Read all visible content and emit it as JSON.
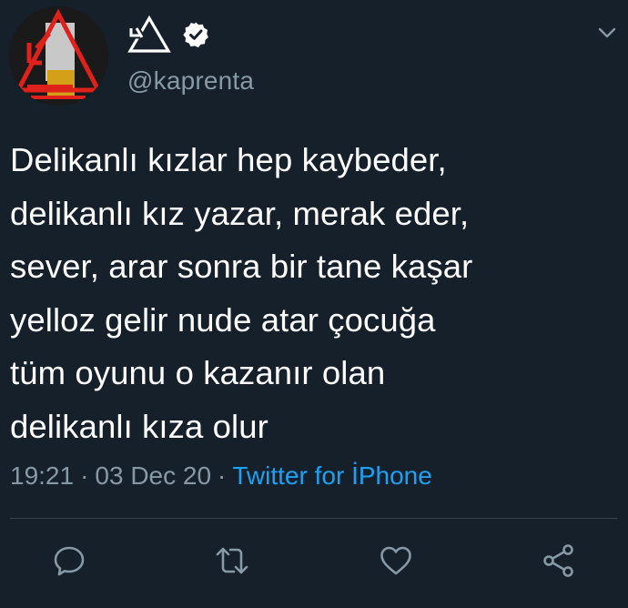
{
  "tweet": {
    "avatar_icon": "profile-avatar-logo",
    "display_name_icon": "triangle-logo-icon",
    "verified_icon": "verified-badge-icon",
    "handle": "@kaprenta",
    "menu_icon": "chevron-down-icon",
    "text_lines": [
      "Delikanlı kızlar hep kaybeder,",
      "delikanlı kız yazar, merak eder,",
      "sever, arar sonra bir tane kaşar",
      "yelloz gelir nude atar çocuğa",
      "tüm oyunu o kazanır olan",
      "delikanlı kıza olur"
    ],
    "time": "19:21",
    "separator": "·",
    "date": "03 Dec 20",
    "source": "Twitter for İPhone"
  },
  "actions": [
    {
      "name": "reply",
      "icon": "reply-icon"
    },
    {
      "name": "retweet",
      "icon": "retweet-icon"
    },
    {
      "name": "like",
      "icon": "like-icon"
    },
    {
      "name": "share",
      "icon": "share-icon"
    }
  ],
  "colors": {
    "background": "#15202b",
    "text": "#ffffff",
    "secondary_text": "#8899a6",
    "link": "#1da1f2",
    "divider": "#38444d"
  }
}
